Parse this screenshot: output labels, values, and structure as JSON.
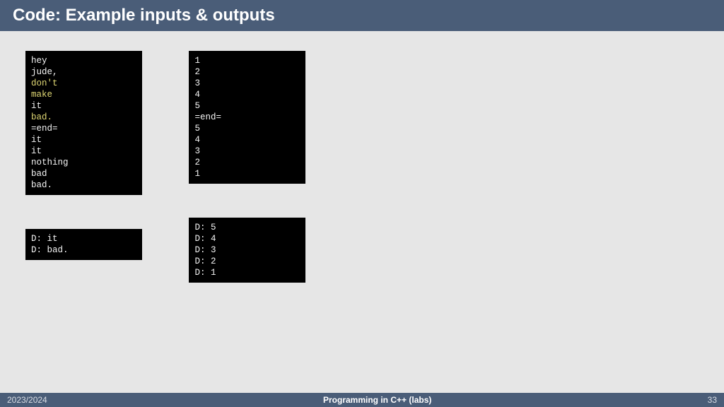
{
  "header": {
    "title": "Code: Example inputs & outputs"
  },
  "blocks": {
    "left_input": [
      {
        "t": "hey",
        "c": "w"
      },
      {
        "t": "jude,",
        "c": "w"
      },
      {
        "t": "don't",
        "c": "y"
      },
      {
        "t": "make",
        "c": "y"
      },
      {
        "t": "it",
        "c": "w"
      },
      {
        "t": "bad.",
        "c": "y"
      },
      {
        "t": "=end=",
        "c": "w"
      },
      {
        "t": "it",
        "c": "w"
      },
      {
        "t": "it",
        "c": "w"
      },
      {
        "t": "nothing",
        "c": "w"
      },
      {
        "t": "bad",
        "c": "w"
      },
      {
        "t": "bad.",
        "c": "w"
      }
    ],
    "right_input": [
      {
        "t": "1",
        "c": "w"
      },
      {
        "t": "2",
        "c": "w"
      },
      {
        "t": "3",
        "c": "w"
      },
      {
        "t": "4",
        "c": "w"
      },
      {
        "t": "5",
        "c": "w"
      },
      {
        "t": "=end=",
        "c": "w"
      },
      {
        "t": "5",
        "c": "w"
      },
      {
        "t": "4",
        "c": "w"
      },
      {
        "t": "3",
        "c": "w"
      },
      {
        "t": "2",
        "c": "w"
      },
      {
        "t": "1",
        "c": "w"
      }
    ],
    "left_output": [
      {
        "t": "D: it",
        "c": "w"
      },
      {
        "t": "D: bad.",
        "c": "w"
      }
    ],
    "right_output": [
      {
        "t": "D: 5",
        "c": "w"
      },
      {
        "t": "D: 4",
        "c": "w"
      },
      {
        "t": "D: 3",
        "c": "w"
      },
      {
        "t": "D: 2",
        "c": "w"
      },
      {
        "t": "D: 1",
        "c": "w"
      }
    ]
  },
  "footer": {
    "left": "2023/2024",
    "center": "Programming in C++ (labs)",
    "right": "33"
  }
}
